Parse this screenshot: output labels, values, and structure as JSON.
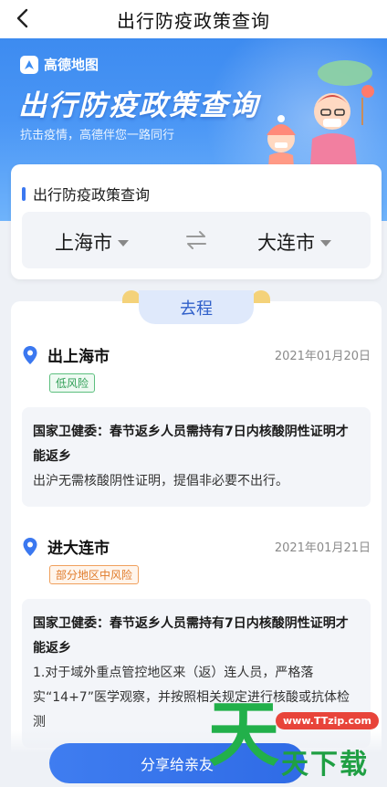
{
  "nav": {
    "title": "出行防疫政策查询"
  },
  "banner": {
    "brand": "高德地图",
    "title": "出行防疫政策查询",
    "subtitle": "抗击疫情，高德伴您一路同行"
  },
  "query": {
    "section_title": "出行防疫政策查询",
    "from_city": "上海市",
    "to_city": "大连市"
  },
  "tab": {
    "label": "去程"
  },
  "departure": {
    "name": "出上海市",
    "date": "2021年01月20日",
    "risk": "低风险",
    "notice_title": "国家卫健委：春节返乡人员需持有7日内核酸阴性证明才能返乡",
    "notice_body": "出沪无需核酸阴性证明，提倡非必要不出行。"
  },
  "arrival": {
    "name": "进大连市",
    "date": "2021年01月21日",
    "risk": "部分地区中风险",
    "notice_title": "国家卫健委：春节返乡人员需持有7日内核酸阴性证明才能返乡",
    "notice_body": "1.对于域外重点管控地区来（返）连人员，严格落实“14+7”医学观察，并按照相关规定进行核酸或抗体检测"
  },
  "share_button": "分享给亲友",
  "watermark": {
    "big": "天",
    "url": "www.TTzip.com",
    "small": "天下载"
  },
  "colors": {
    "accent": "#3b78f0",
    "low_risk": "#2f9e55",
    "mid_risk": "#e07c2c"
  }
}
